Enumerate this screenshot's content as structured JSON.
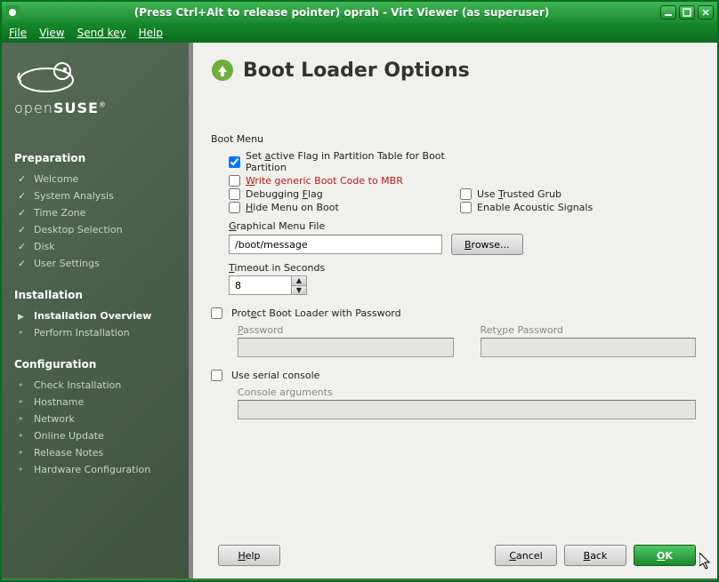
{
  "titlebar": {
    "text": "(Press Ctrl+Alt to release pointer) oprah - Virt Viewer (as superuser)"
  },
  "menubar": {
    "file": "File",
    "view": "View",
    "sendkey": "Send key",
    "help": "Help"
  },
  "logo": {
    "brand_thin": "open",
    "brand_bold": "SUSE"
  },
  "sidebar": {
    "sections": [
      {
        "title": "Preparation",
        "items": [
          {
            "label": "Welcome",
            "state": "done"
          },
          {
            "label": "System Analysis",
            "state": "done"
          },
          {
            "label": "Time Zone",
            "state": "done"
          },
          {
            "label": "Desktop Selection",
            "state": "done"
          },
          {
            "label": "Disk",
            "state": "done"
          },
          {
            "label": "User Settings",
            "state": "done"
          }
        ]
      },
      {
        "title": "Installation",
        "items": [
          {
            "label": "Installation Overview",
            "state": "current"
          },
          {
            "label": "Perform Installation",
            "state": "pending"
          }
        ]
      },
      {
        "title": "Configuration",
        "items": [
          {
            "label": "Check Installation",
            "state": "pending"
          },
          {
            "label": "Hostname",
            "state": "pending"
          },
          {
            "label": "Network",
            "state": "pending"
          },
          {
            "label": "Online Update",
            "state": "pending"
          },
          {
            "label": "Release Notes",
            "state": "pending"
          },
          {
            "label": "Hardware Configuration",
            "state": "pending"
          }
        ]
      }
    ]
  },
  "page": {
    "title": "Boot Loader Options",
    "boot_menu_label": "Boot Menu",
    "chk_active_flag": "Set active Flag in Partition Table for Boot Partition",
    "chk_write_mbr": "Write generic Boot Code to MBR",
    "chk_debug": "Debugging Flag",
    "chk_trusted": "Use Trusted Grub",
    "chk_hide": "Hide Menu on Boot",
    "chk_acoustic": "Enable Acoustic Signals",
    "gmf_label": "Graphical Menu File",
    "gmf_value": "/boot/message",
    "browse": "Browse...",
    "timeout_label": "Timeout in Seconds",
    "timeout_value": "8",
    "protect_label": "Protect Boot Loader with Password",
    "password_label": "Password",
    "retype_label": "Retype Password",
    "serial_label": "Use serial console",
    "console_args_label": "Console arguments"
  },
  "footer": {
    "help": "Help",
    "cancel": "Cancel",
    "back": "Back",
    "ok": "OK"
  }
}
